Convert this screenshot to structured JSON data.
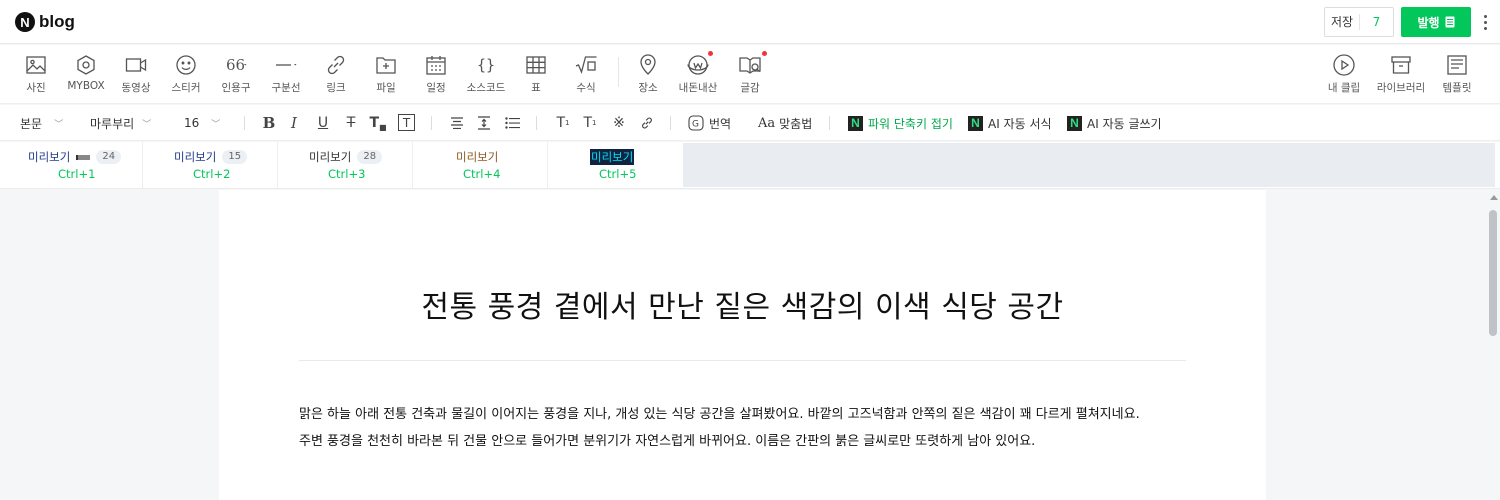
{
  "header": {
    "logo_mark": "N",
    "logo_text": "blog",
    "save_label": "저장",
    "save_count": "7",
    "publish_label": "발행"
  },
  "insert_tools": [
    {
      "label": "사진",
      "icon": "photo-icon"
    },
    {
      "label": "MYBOX",
      "icon": "mybox-icon"
    },
    {
      "label": "동영상",
      "icon": "video-icon"
    },
    {
      "label": "스티커",
      "icon": "sticker-icon"
    },
    {
      "label": "인용구",
      "icon": "quote-icon",
      "glyph": "66"
    },
    {
      "label": "구분선",
      "icon": "divider-icon"
    },
    {
      "label": "링크",
      "icon": "link-icon"
    },
    {
      "label": "파일",
      "icon": "file-icon"
    },
    {
      "label": "일정",
      "icon": "calendar-icon"
    },
    {
      "label": "소스코드",
      "icon": "source-code-icon",
      "glyph": "{ }"
    },
    {
      "label": "표",
      "icon": "table-icon"
    },
    {
      "label": "수식",
      "icon": "formula-icon",
      "glyph": "√□"
    },
    {
      "label": "장소",
      "icon": "place-icon"
    },
    {
      "label": "내돈내산",
      "icon": "my-money-icon"
    },
    {
      "label": "글감",
      "icon": "writing-material-icon"
    }
  ],
  "right_tools": [
    {
      "label": "내 클립",
      "icon": "clip-icon"
    },
    {
      "label": "라이브러리",
      "icon": "library-icon"
    },
    {
      "label": "템플릿",
      "icon": "template-icon"
    }
  ],
  "format": {
    "paragraph_style": "본문",
    "font_family": "마루부리",
    "font_size": "16",
    "translate_label": "번역",
    "spellcheck_label": "맞춤법",
    "spellcheck_icon_text": "Aa",
    "power_shortcut_label": "파워 단축키 접기",
    "ai_format_label": "AI 자동 서식",
    "ai_writing_label": "AI 자동 글쓰기",
    "badge_letter": "N"
  },
  "previews": [
    {
      "title": "미리보기",
      "count": "24",
      "shortcut": "Ctrl+1",
      "color": "#1f3a8a"
    },
    {
      "title": "미리보기",
      "count": "15",
      "shortcut": "Ctrl+2",
      "color": "#1f3a8a"
    },
    {
      "title": "미리보기",
      "count": "28",
      "shortcut": "Ctrl+3",
      "color": "#333333"
    },
    {
      "title": "미리보기",
      "count": "",
      "shortcut": "Ctrl+4",
      "color": "#8a5a1f"
    },
    {
      "title": "미리보기",
      "count": "",
      "shortcut": "Ctrl+5",
      "color": "#00e0ff",
      "highlight": "#10233f"
    }
  ],
  "document": {
    "title": "전통 풍경 곁에서 만난 짙은 색감의 이색 식당 공간",
    "paragraph_1": "맑은 하늘 아래 전통 건축과 물길이 이어지는 풍경을 지나, 개성 있는 식당 공간을 살펴봤어요. 바깥의 고즈넉함과 안쪽의 짙은 색감이 꽤 다르게 펼쳐지네요.",
    "paragraph_2": "주변 풍경을 천천히 바라본 뒤 건물 안으로 들어가면 분위기가 자연스럽게 바뀌어요. 이름은 간판의 붉은 글씨로만 또렷하게 남아 있어요."
  },
  "colors": {
    "accent": "#03c75a",
    "notification_dot": "#f0343c"
  }
}
